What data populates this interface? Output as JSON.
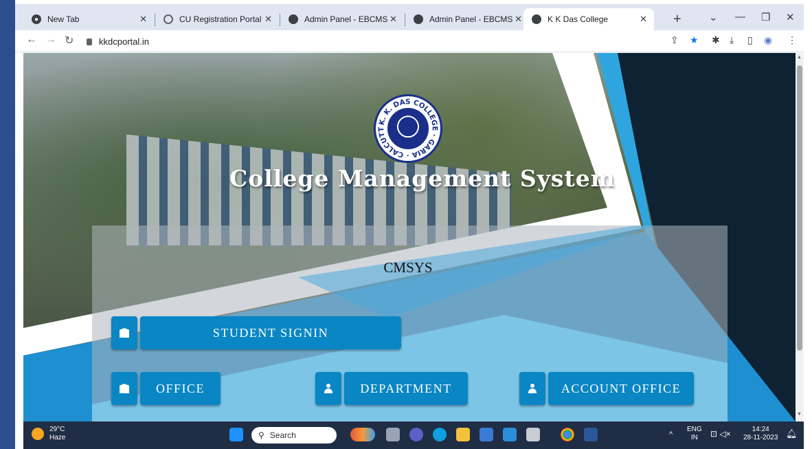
{
  "browser": {
    "tabs": [
      {
        "label": "New Tab",
        "icon": "chrome-icon"
      },
      {
        "label": "CU Registration Portal",
        "icon": "portal-icon"
      },
      {
        "label": "Admin Panel - EBCMS",
        "icon": "globe-icon"
      },
      {
        "label": "Admin Panel - EBCMS",
        "icon": "globe-icon"
      },
      {
        "label": "K K Das College",
        "icon": "globe-icon"
      }
    ],
    "active_tab": 4,
    "url": "kkdcportal.in"
  },
  "page": {
    "logo_text": "K. K. DAS COLLEGE · GARIA · CALCUTTA",
    "title": "College Management System",
    "subtitle": "CMSYS",
    "buttons": {
      "student": "STUDENT SIGNIN",
      "office": "OFFICE",
      "department": "DEPARTMENT",
      "account": "ACCOUNT OFFICE"
    },
    "colors": {
      "button": "#0a86c4",
      "accent": "#2fa5df",
      "dark": "#0f2233"
    }
  },
  "taskbar": {
    "weather_temp": "29°C",
    "weather_desc": "Haze",
    "search_placeholder": "Search",
    "lang_top": "ENG",
    "lang_bottom": "IN",
    "time": "14:24",
    "date": "28-11-2023"
  }
}
